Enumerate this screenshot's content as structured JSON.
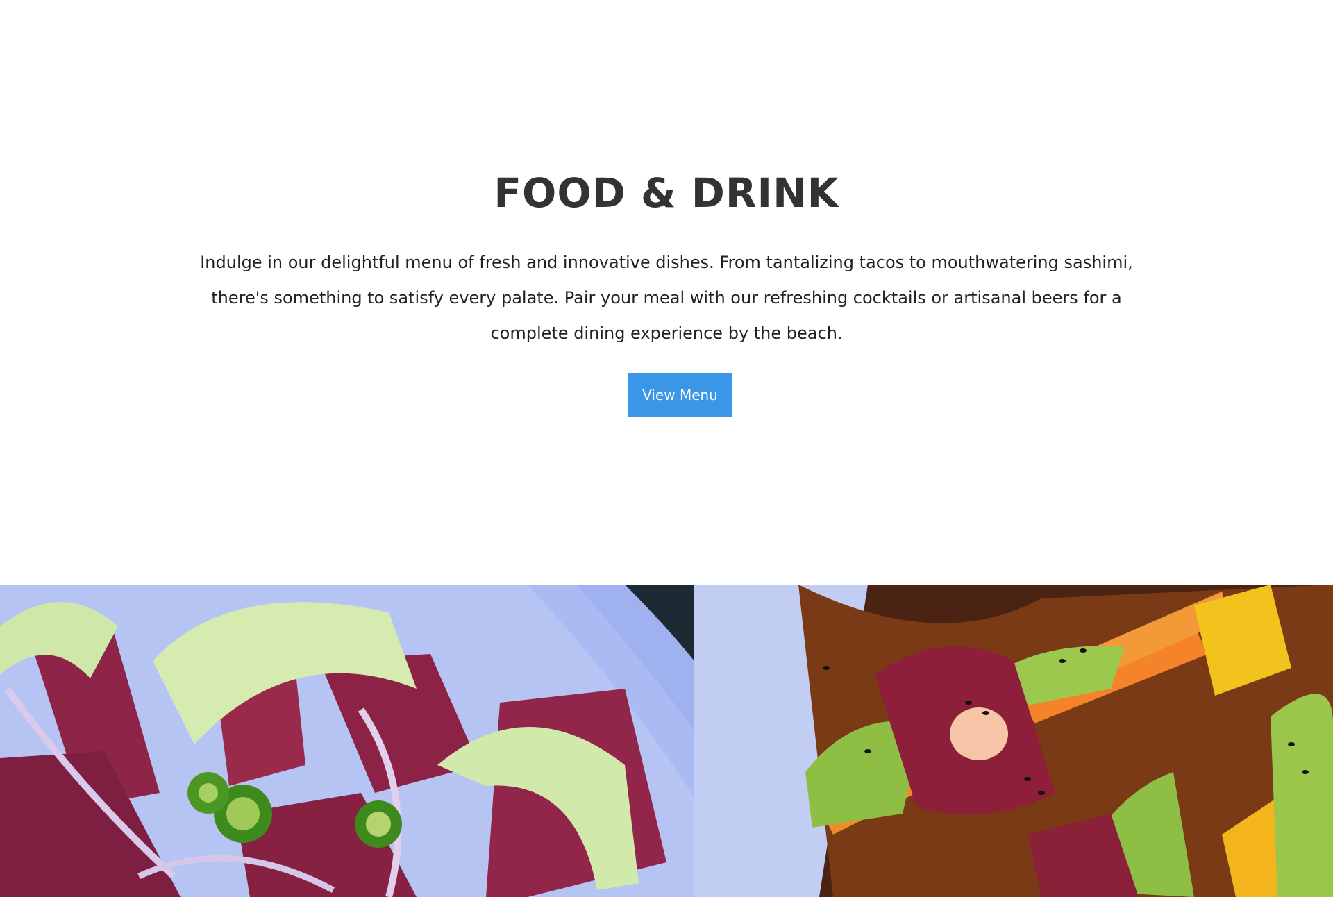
{
  "section": {
    "title": "FOOD & DRINK",
    "description": "Indulge in our delightful menu of fresh and innovative dishes. From tantalizing tacos to mouthwatering sashimi, there's something to satisfy every palate. Pair your meal with our refreshing cocktails or artisanal beers for a complete dining experience by the beach.",
    "cta_label": "View Menu"
  },
  "colors": {
    "title": "#333333",
    "text": "#222222",
    "button": "#3a97e8",
    "button_text": "#ffffff"
  },
  "gallery": {
    "image_left": "tuna-sashimi-plate-image",
    "image_right": "tuna-avocado-rolls-image"
  }
}
